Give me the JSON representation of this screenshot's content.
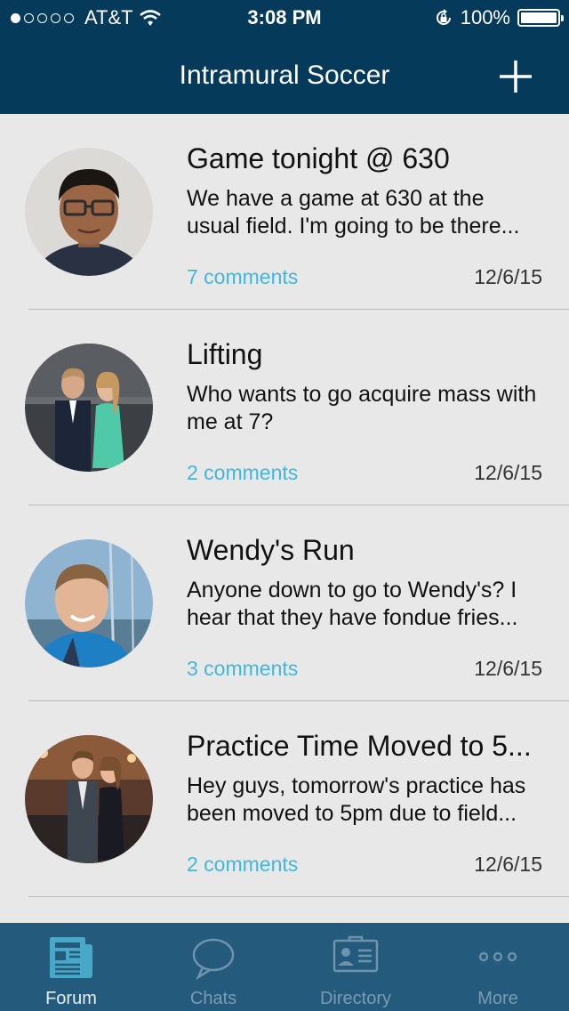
{
  "status": {
    "carrier": "AT&T",
    "time": "3:08 PM",
    "battery": "100%",
    "signal_bars": 1,
    "battery_level": 1.0
  },
  "nav": {
    "title": "Intramural Soccer",
    "add_icon": "plus-icon"
  },
  "posts": [
    {
      "title": "Game tonight @ 630",
      "body": "We have a game at 630 at the usual field. I'm going to be there...",
      "comments": "7 comments",
      "date": "12/6/15"
    },
    {
      "title": "Lifting",
      "body": "Who wants to go acquire mass with me at 7?",
      "comments": "2 comments",
      "date": "12/6/15"
    },
    {
      "title": "Wendy's Run",
      "body": "Anyone down to go to Wendy's? I hear that they have fondue fries...",
      "comments": "3 comments",
      "date": "12/6/15"
    },
    {
      "title": "Practice Time Moved to 5...",
      "body": "Hey guys, tomorrow's practice has been moved to 5pm due to field...",
      "comments": "2 comments",
      "date": "12/6/15"
    }
  ],
  "tabs": [
    {
      "label": "Forum",
      "icon": "newspaper-icon",
      "active": true
    },
    {
      "label": "Chats",
      "icon": "chat-bubble-icon",
      "active": false
    },
    {
      "label": "Directory",
      "icon": "contact-card-icon",
      "active": false
    },
    {
      "label": "More",
      "icon": "more-dots-icon",
      "active": false
    }
  ],
  "colors": {
    "nav_bg": "#053a5a",
    "tab_bg": "#245a7c",
    "list_bg": "#e8e8e8",
    "accent": "#3fb8de"
  }
}
